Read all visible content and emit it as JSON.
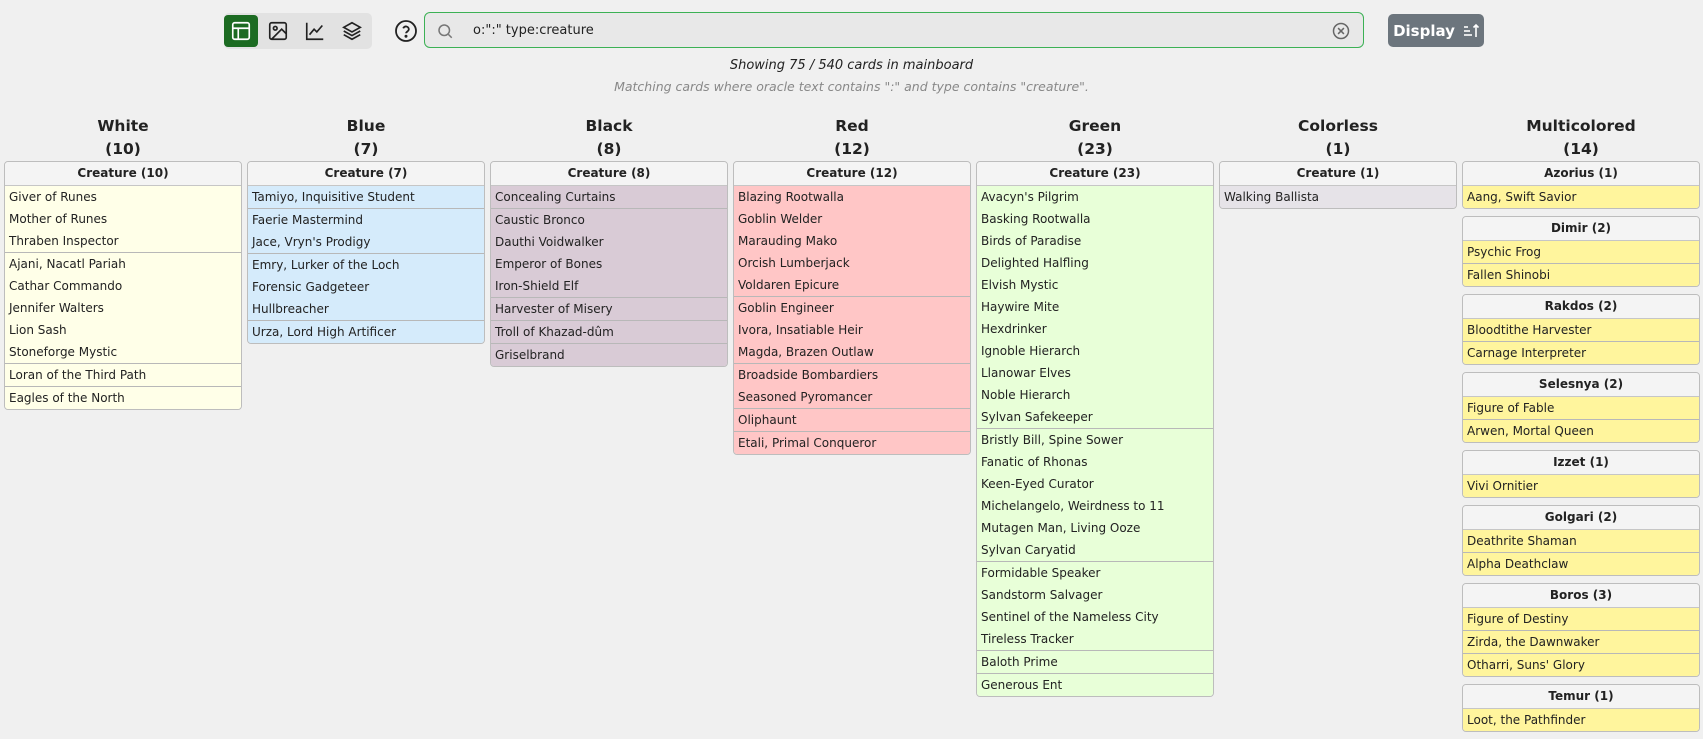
{
  "toolbar": {
    "views": [
      {
        "icon": "table-icon",
        "active": true
      },
      {
        "icon": "image-icon",
        "active": false
      },
      {
        "icon": "chart-line-icon",
        "active": false
      },
      {
        "icon": "stack-layers-icon",
        "active": false
      }
    ],
    "help_icon": "help-circle-icon",
    "search": {
      "value": "o:\":\" type:creature",
      "icon": "search-icon",
      "clear_icon": "clear-circle-icon"
    },
    "display_label": "Display",
    "display_icon": "sort-ascending-icon"
  },
  "summary": {
    "line1": "Showing 75 / 540 cards in mainboard",
    "line2": "Matching cards where oracle text contains \":\" and type contains \"creature\"."
  },
  "colors": {
    "accent": "#1c6b22",
    "search_border": "#3cb155",
    "display_button": "#6c757d"
  },
  "columns": [
    {
      "title": "White",
      "count": "(10)",
      "bg": "#ffffe8",
      "groups": [
        {
          "label": "Creature (10)",
          "cards": [
            {
              "name": "Giver of Runes"
            },
            {
              "name": "Mother of Runes"
            },
            {
              "name": "Thraben Inspector"
            },
            {
              "name": "Ajani, Nacatl Pariah",
              "sep": true
            },
            {
              "name": "Cathar Commando"
            },
            {
              "name": "Jennifer Walters"
            },
            {
              "name": "Lion Sash"
            },
            {
              "name": "Stoneforge Mystic"
            },
            {
              "name": "Loran of the Third Path",
              "sep": true
            },
            {
              "name": "Eagles of the North",
              "sep": true
            }
          ]
        }
      ]
    },
    {
      "title": "Blue",
      "count": "(7)",
      "bg": "#d5ebfb",
      "groups": [
        {
          "label": "Creature (7)",
          "cards": [
            {
              "name": "Tamiyo, Inquisitive Student"
            },
            {
              "name": "Faerie Mastermind",
              "sep": true
            },
            {
              "name": "Jace, Vryn's Prodigy"
            },
            {
              "name": "Emry, Lurker of the Loch",
              "sep": true
            },
            {
              "name": "Forensic Gadgeteer"
            },
            {
              "name": "Hullbreacher"
            },
            {
              "name": "Urza, Lord High Artificer",
              "sep": true
            }
          ]
        }
      ]
    },
    {
      "title": "Black",
      "count": "(8)",
      "bg": "#d9cbd6",
      "groups": [
        {
          "label": "Creature (8)",
          "cards": [
            {
              "name": "Concealing Curtains"
            },
            {
              "name": "Caustic Bronco",
              "sep": true
            },
            {
              "name": "Dauthi Voidwalker"
            },
            {
              "name": "Emperor of Bones"
            },
            {
              "name": "Iron-Shield Elf"
            },
            {
              "name": "Harvester of Misery",
              "sep": true
            },
            {
              "name": "Troll of Khazad-dûm",
              "sep": true
            },
            {
              "name": "Griselbrand",
              "sep": true
            }
          ]
        }
      ]
    },
    {
      "title": "Red",
      "count": "(12)",
      "bg": "#ffc6c6",
      "groups": [
        {
          "label": "Creature (12)",
          "cards": [
            {
              "name": "Blazing Rootwalla"
            },
            {
              "name": "Goblin Welder"
            },
            {
              "name": "Marauding Mako"
            },
            {
              "name": "Orcish Lumberjack"
            },
            {
              "name": "Voldaren Epicure"
            },
            {
              "name": "Goblin Engineer",
              "sep": true
            },
            {
              "name": "Ivora, Insatiable Heir"
            },
            {
              "name": "Magda, Brazen Outlaw"
            },
            {
              "name": "Broadside Bombardiers",
              "sep": true
            },
            {
              "name": "Seasoned Pyromancer"
            },
            {
              "name": "Oliphaunt",
              "sep": true
            },
            {
              "name": "Etali, Primal Conqueror",
              "sep": true
            }
          ]
        }
      ]
    },
    {
      "title": "Green",
      "count": "(23)",
      "bg": "#e8ffd8",
      "groups": [
        {
          "label": "Creature (23)",
          "cards": [
            {
              "name": "Avacyn's Pilgrim"
            },
            {
              "name": "Basking Rootwalla"
            },
            {
              "name": "Birds of Paradise"
            },
            {
              "name": "Delighted Halfling"
            },
            {
              "name": "Elvish Mystic"
            },
            {
              "name": "Haywire Mite"
            },
            {
              "name": "Hexdrinker"
            },
            {
              "name": "Ignoble Hierarch"
            },
            {
              "name": "Llanowar Elves"
            },
            {
              "name": "Noble Hierarch"
            },
            {
              "name": "Sylvan Safekeeper"
            },
            {
              "name": "Bristly Bill, Spine Sower",
              "sep": true
            },
            {
              "name": "Fanatic of Rhonas"
            },
            {
              "name": "Keen-Eyed Curator"
            },
            {
              "name": "Michelangelo, Weirdness to 11"
            },
            {
              "name": "Mutagen Man, Living Ooze"
            },
            {
              "name": "Sylvan Caryatid"
            },
            {
              "name": "Formidable Speaker",
              "sep": true
            },
            {
              "name": "Sandstorm Salvager"
            },
            {
              "name": "Sentinel of the Nameless City"
            },
            {
              "name": "Tireless Tracker"
            },
            {
              "name": "Baloth Prime",
              "sep": true
            },
            {
              "name": "Generous Ent",
              "sep": true
            }
          ]
        }
      ]
    },
    {
      "title": "Colorless",
      "count": "(1)",
      "bg": "#e6e3e8",
      "groups": [
        {
          "label": "Creature (1)",
          "cards": [
            {
              "name": "Walking Ballista"
            }
          ]
        }
      ]
    },
    {
      "title": "Multicolored",
      "count": "(14)",
      "bg": "#fff59d",
      "groups": [
        {
          "label": "Azorius (1)",
          "cards": [
            {
              "name": "Aang, Swift Savior"
            }
          ]
        },
        {
          "label": "Dimir (2)",
          "cards": [
            {
              "name": "Psychic Frog"
            },
            {
              "name": "Fallen Shinobi",
              "sep": true
            }
          ]
        },
        {
          "label": "Rakdos (2)",
          "cards": [
            {
              "name": "Bloodtithe Harvester"
            },
            {
              "name": "Carnage Interpreter",
              "sep": true
            }
          ]
        },
        {
          "label": "Selesnya (2)",
          "cards": [
            {
              "name": "Figure of Fable"
            },
            {
              "name": "Arwen, Mortal Queen",
              "sep": true
            }
          ]
        },
        {
          "label": "Izzet (1)",
          "cards": [
            {
              "name": "Vivi Ornitier"
            }
          ]
        },
        {
          "label": "Golgari (2)",
          "cards": [
            {
              "name": "Deathrite Shaman"
            },
            {
              "name": "Alpha Deathclaw",
              "sep": true
            }
          ]
        },
        {
          "label": "Boros (3)",
          "cards": [
            {
              "name": "Figure of Destiny"
            },
            {
              "name": "Zirda, the Dawnwaker",
              "sep": true
            },
            {
              "name": "Otharri, Suns' Glory",
              "sep": true
            }
          ]
        },
        {
          "label": "Temur (1)",
          "cards": [
            {
              "name": "Loot, the Pathfinder"
            }
          ]
        }
      ]
    }
  ]
}
